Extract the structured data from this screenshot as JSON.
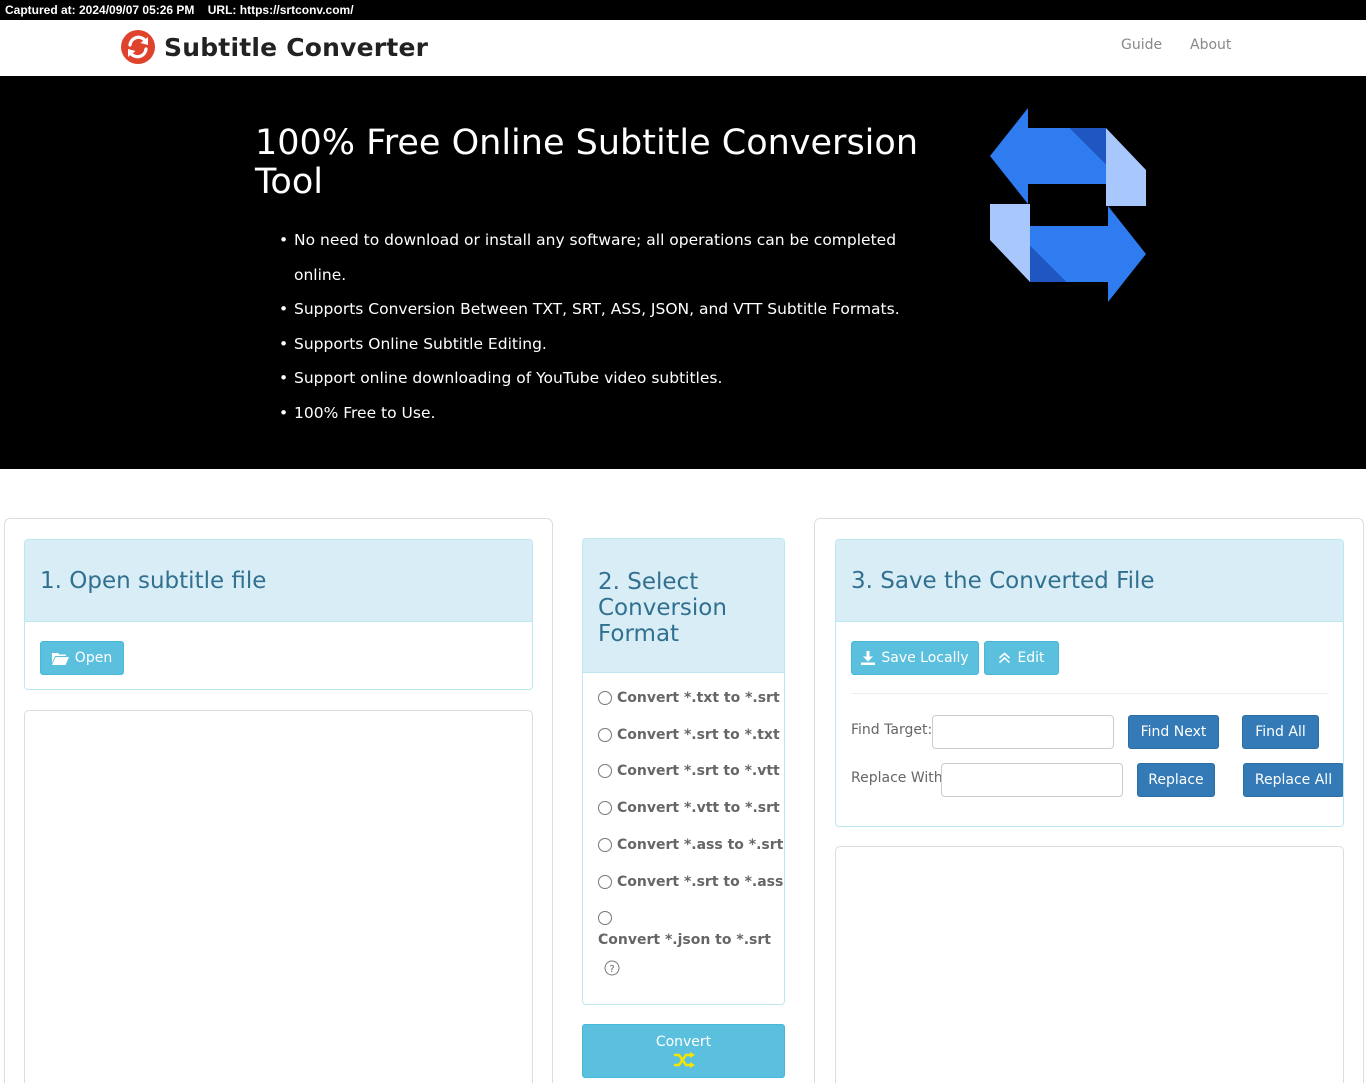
{
  "capture": {
    "text": "Captured at: 2024/09/07 05:26 PM    URL: https://srtconv.com/"
  },
  "brand": {
    "name": "Subtitle Converter",
    "logo_icon": "refresh-circle-icon",
    "logo_color": "#e0432c"
  },
  "nav": {
    "guide": "Guide",
    "about": "About"
  },
  "hero": {
    "title": "100% Free Online Subtitle Conversion Tool",
    "features": [
      "No need to download or install any software; all operations can be completed online.",
      "Supports Conversion Between TXT, SRT, ASS, JSON, and VTT Subtitle Formats.",
      "Supports Online Subtitle Editing.",
      "Support online downloading of YouTube video subtitles.",
      "100% Free to Use."
    ],
    "art_icon": "convert-arrows-icon"
  },
  "step1": {
    "title": "1. Open subtitle file",
    "open_button": "Open",
    "open_icon": "folder-open-icon",
    "editor_content": ""
  },
  "step2": {
    "title": "2. Select Conversion Format",
    "options": [
      "Convert *.txt to *.srt",
      "Convert *.srt to *.txt",
      "Convert *.srt to *.vtt",
      "Convert *.vtt to *.srt",
      "Convert *.ass to *.srt",
      "Convert *.srt to *.ass",
      "Convert *.json to *.srt"
    ],
    "help_icon": "question-circle-icon",
    "convert_button": "Convert",
    "convert_icon": "shuffle-icon"
  },
  "step3": {
    "title": "3. Save the Converted File",
    "save_button": "Save Locally",
    "save_icon": "download-icon",
    "edit_button": "Edit",
    "edit_icon": "chevron-up-icon",
    "find_label": "Find Target:",
    "find_value": "",
    "replace_label": "Replace With:",
    "replace_value": "",
    "find_next": "Find Next",
    "find_all": "Find All",
    "replace": "Replace",
    "replace_all": "Replace All",
    "output_content": ""
  },
  "colors": {
    "info": "#5bc0de",
    "primary": "#337ab7",
    "heading_bg": "#d9edf7",
    "heading_text": "#31708f",
    "hero_bg": "#000000",
    "shuffle_icon": "#f7e400"
  }
}
